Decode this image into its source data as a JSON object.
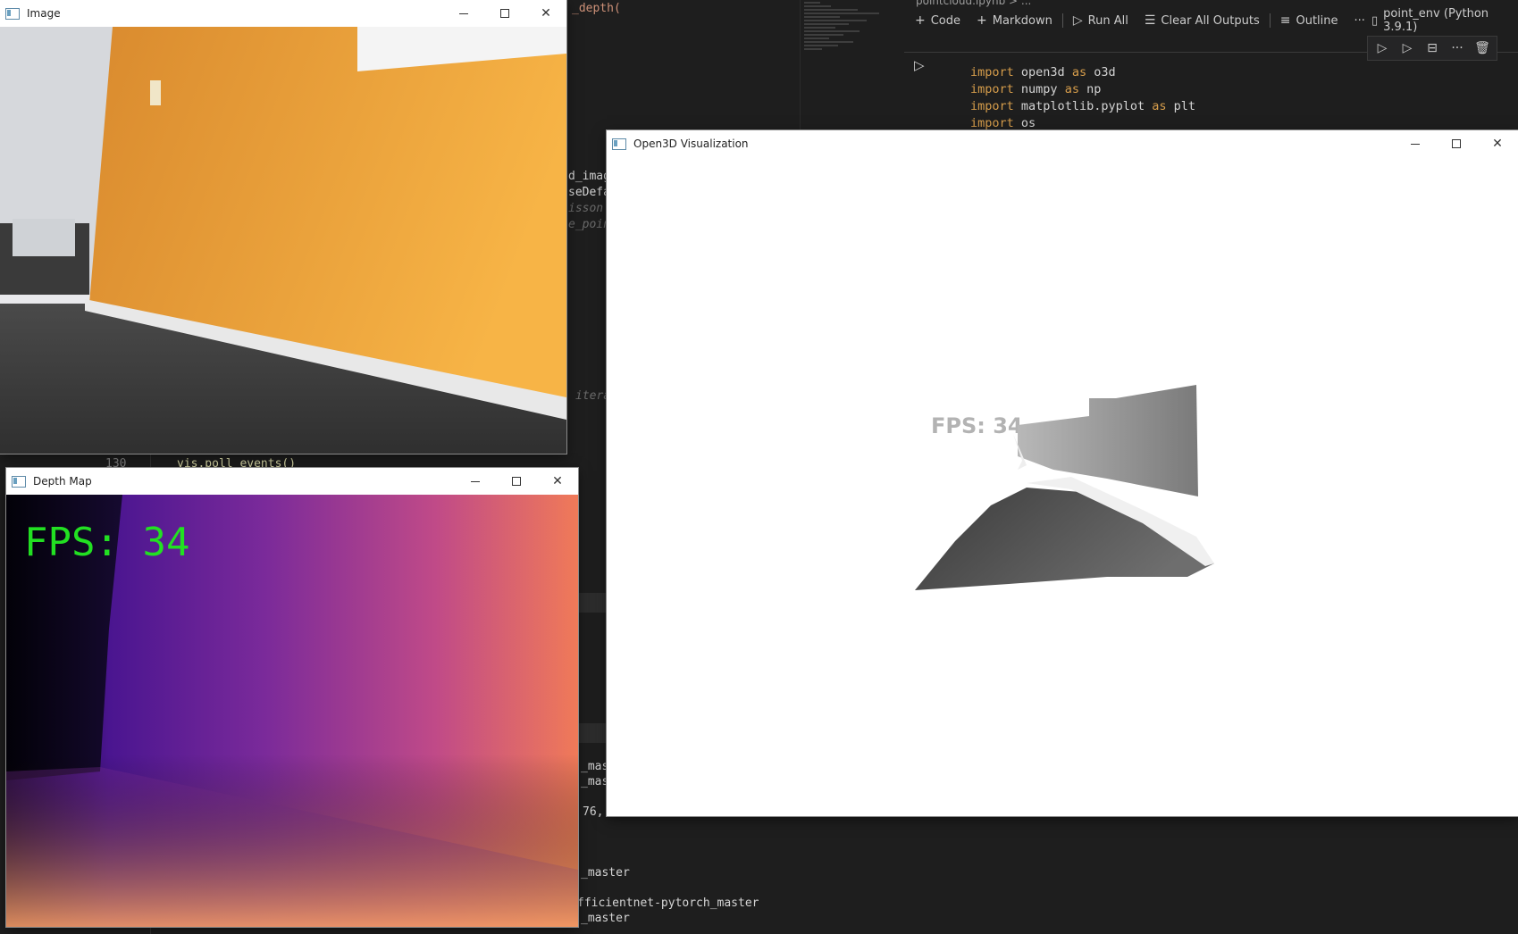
{
  "notebook": {
    "breadcrumb": "pointcloud.ipynb > ...",
    "toolbar": {
      "code": "Code",
      "markdown": "Markdown",
      "run_all": "Run All",
      "clear_all_outputs": "Clear All Outputs",
      "outline": "Outline",
      "more": "···"
    },
    "kernel": "point_env (Python 3.9.1)",
    "cell_code": [
      {
        "kw": "import",
        "mod": "open3d",
        "as": "as",
        "alias": "o3d"
      },
      {
        "kw": "import",
        "mod": "numpy",
        "as": "as",
        "alias": "np"
      },
      {
        "kw": "import",
        "mod": "matplotlib.pyplot",
        "as": "as",
        "alias": "plt"
      },
      {
        "kw": "import",
        "mod": "os",
        "as": "",
        "alias": ""
      }
    ]
  },
  "editor_fragments": {
    "f1": "_depth(",
    "f2": "d_image",
    "f3": "seDefau",
    "f4": "isson s",
    "f5": "e_point",
    "f6": "itera",
    "line_number": "130",
    "poll_line": "vis.poll_events()",
    "f7": "_mast",
    "f8": "_mast",
    "f9": "76,",
    "f10": "_master",
    "f11": "fficientnet-pytorch_master",
    "f12": "_master"
  },
  "windows": {
    "image": {
      "title": "Image"
    },
    "depth": {
      "title": "Depth Map",
      "fps_text": "FPS: 34"
    },
    "open3d": {
      "title": "Open3D Visualization",
      "fps_text": "FPS: 34"
    }
  },
  "colors": {
    "fps_green": "#22e022",
    "vscode_bg": "#1e1e1e"
  }
}
